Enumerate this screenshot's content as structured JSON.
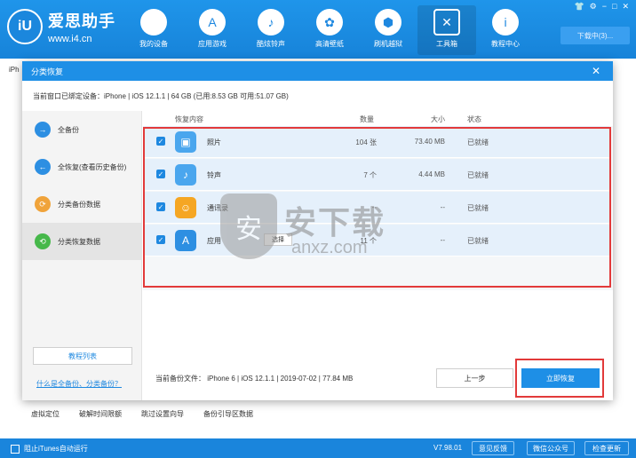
{
  "app": {
    "logo_mark": "iU",
    "title": "爱思助手",
    "url": "www.i4.cn",
    "download_label": "下载中(3)...",
    "nav": [
      {
        "label": "我的设备",
        "icon": "apple-icon",
        "glyph": ""
      },
      {
        "label": "应用游戏",
        "icon": "app-store-icon",
        "glyph": "A"
      },
      {
        "label": "酷炫铃声",
        "icon": "bell-icon",
        "glyph": "♪"
      },
      {
        "label": "高清壁纸",
        "icon": "flower-icon",
        "glyph": "✿"
      },
      {
        "label": "刷机越狱",
        "icon": "box-icon",
        "glyph": "⬢"
      },
      {
        "label": "工具箱",
        "icon": "tools-icon",
        "glyph": "✕"
      },
      {
        "label": "教程中心",
        "icon": "info-icon",
        "glyph": "i"
      }
    ],
    "window_controls": [
      "shirt-icon",
      "gear-icon",
      "minimize-icon",
      "maximize-icon",
      "close-icon"
    ]
  },
  "background": {
    "device_tab": "iPh",
    "tools": [
      "虚拟定位",
      "破解时间限额",
      "跳过设置向导",
      "备份引导区数据"
    ]
  },
  "statusbar": {
    "itunes_label": "阻止iTunes自动运行",
    "version": "V7.98.01",
    "feedback": "意见反馈",
    "wechat": "微信公众号",
    "update": "检查更新"
  },
  "dialog": {
    "title": "分类恢复",
    "device_info": "当前窗口已绑定设备：iPhone  |  iOS 12.1.1  |  64 GB (已用:8.53 GB 可用:51.07 GB)",
    "sidebar": [
      {
        "label": "全备份",
        "color": "#2d8fe2",
        "glyph": "→"
      },
      {
        "label": "全恢复(查看历史备份)",
        "color": "#2d8fe2",
        "glyph": "←"
      },
      {
        "label": "分类备份数据",
        "color": "#f0a33a",
        "glyph": "⟳"
      },
      {
        "label": "分类恢复数据",
        "color": "#46b84a",
        "glyph": "⟲"
      }
    ],
    "tutorial_button": "教程列表",
    "help_link": "什么是全备份、分类备份？",
    "columns": {
      "content": "恢复内容",
      "count": "数量",
      "size": "大小",
      "status": "状态"
    },
    "rows": [
      {
        "name": "照片",
        "count": "104 张",
        "size": "73.40 MB",
        "status": "已就绪",
        "icon_color": "#4aa6ee",
        "glyph": "▣"
      },
      {
        "name": "铃声",
        "count": "7 个",
        "size": "4.44 MB",
        "status": "已就绪",
        "icon_color": "#4aa6ee",
        "glyph": "♪"
      },
      {
        "name": "通讯录",
        "count": "--",
        "size": "--",
        "status": "已就绪",
        "icon_color": "#f5a623",
        "glyph": "☺"
      },
      {
        "name": "应用",
        "count": "11 个",
        "size": "--",
        "status": "已就绪",
        "icon_color": "#2d8fe2",
        "glyph": "A",
        "select": "选择"
      }
    ],
    "footer_file": "当前备份文件：  iPhone 6 | iOS 12.1.1 | 2019-07-02 | 77.84 MB",
    "prev_button": "上一步",
    "restore_button": "立即恢复"
  },
  "watermark": {
    "cn": "安下载",
    "en": "anxz.com",
    "glyph": "安"
  }
}
